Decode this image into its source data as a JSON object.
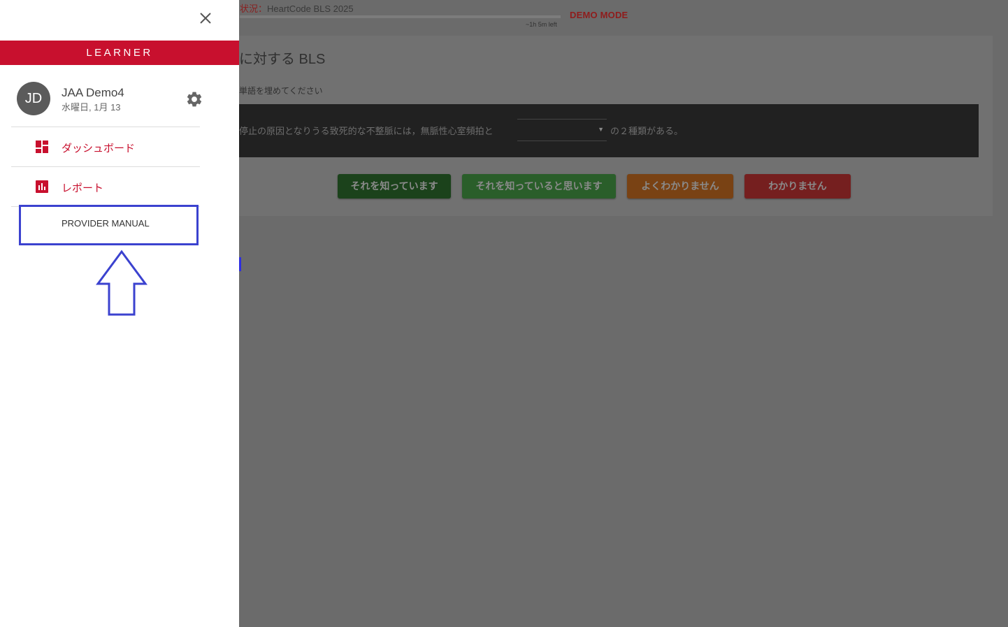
{
  "background_page": {
    "status_prefix": "状況：",
    "course_name": "HeartCode BLS 2025",
    "time_left": "~1h 5m left",
    "demo_mode": "DEMO MODE",
    "card_title": "に対する BLS",
    "instruction": "単語を埋めてください",
    "question_text": "停止の原因となりうる致死的な不整脈には，無脈性心室頻拍と",
    "question_select_value": "",
    "question_suffix": "の２種類がある。",
    "answer_buttons": [
      {
        "label": "それを知っています",
        "color": "#1b421b"
      },
      {
        "label": "それを知っていると思います",
        "color": "#2a5e2a"
      },
      {
        "label": "よくわかりません",
        "color": "#794214"
      },
      {
        "label": "わかりません",
        "color": "#751f1f"
      }
    ]
  },
  "drawer": {
    "close_icon": "close-icon",
    "role_label": "LEARNER",
    "role_color": "#c8102e",
    "user": {
      "initials": "JD",
      "name": "JAA Demo4",
      "date": "水曜日, 1月 13"
    },
    "settings_icon": "gear-icon",
    "nav_items": [
      {
        "label": "ダッシュボード",
        "icon": "dashboard-icon"
      },
      {
        "label": "レポート",
        "icon": "report-chart-icon"
      }
    ],
    "manual_label": "PROVIDER MANUAL",
    "annotation_color": "#3b42cf"
  }
}
